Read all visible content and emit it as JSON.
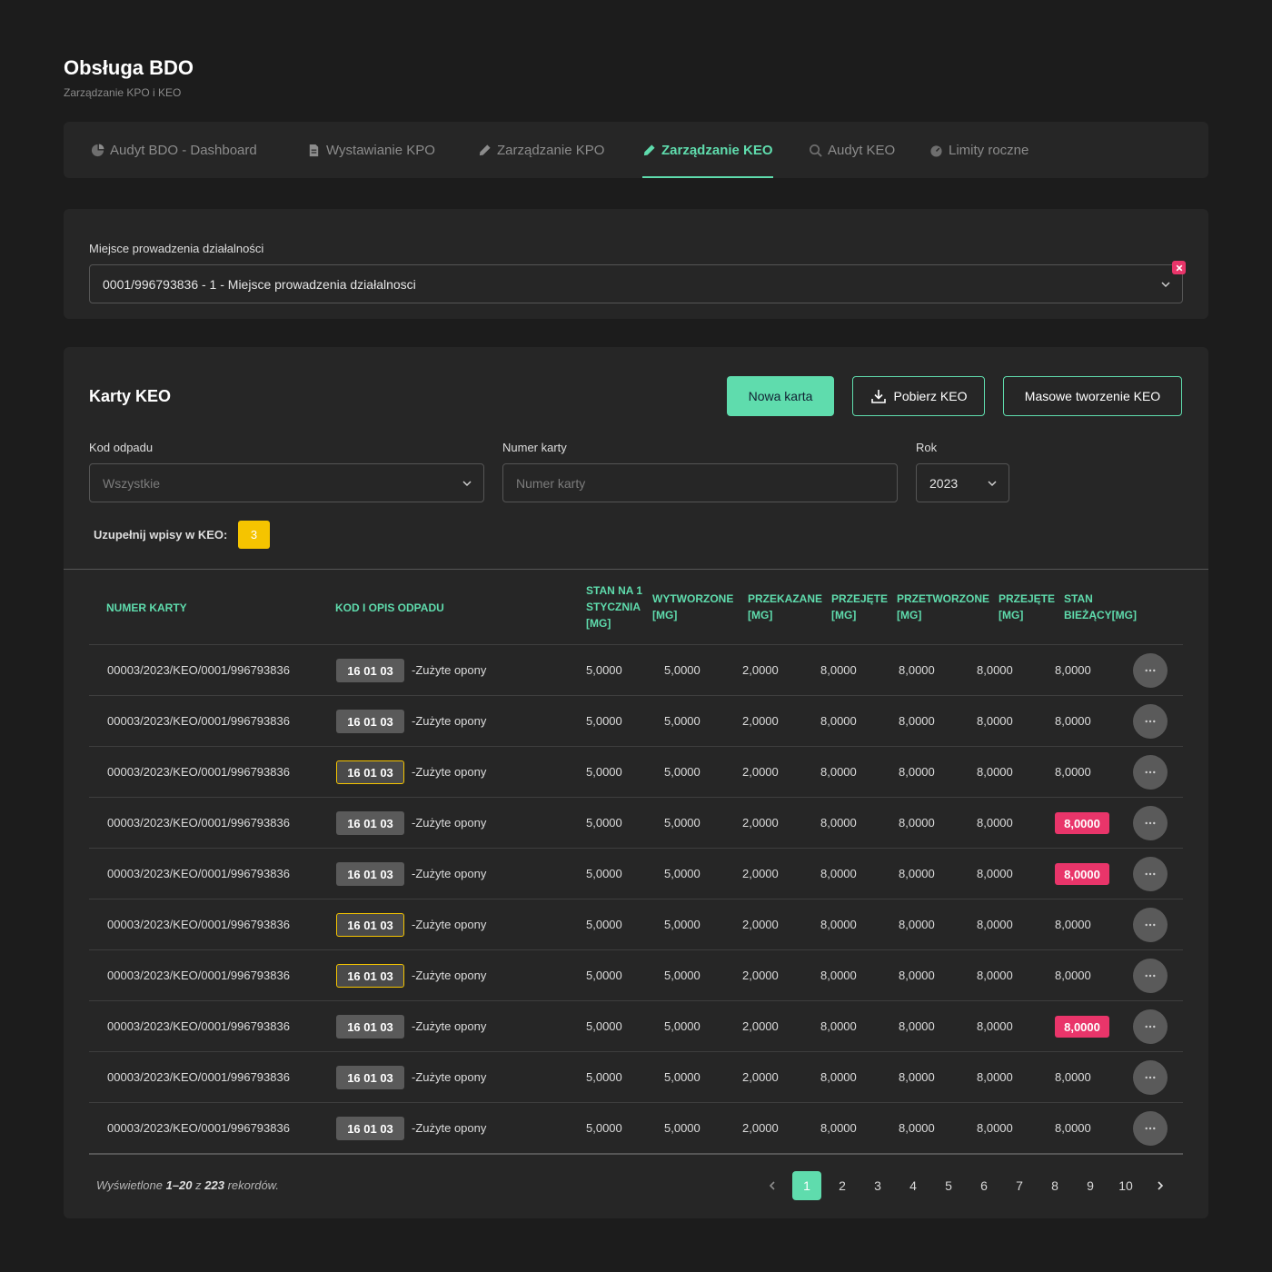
{
  "header": {
    "title": "Obsługa BDO",
    "subtitle": "Zarządzanie KPO i KEO"
  },
  "tabs": [
    {
      "label": "Audyt BDO - Dashboard",
      "icon": "pie-chart-icon"
    },
    {
      "label": "Wystawianie KPO",
      "icon": "document-icon"
    },
    {
      "label": "Zarządzanie KPO",
      "icon": "pencil-icon"
    },
    {
      "label": "Zarządzanie KEO",
      "icon": "pencil-icon",
      "active": true
    },
    {
      "label": "Audyt KEO",
      "icon": "search-icon"
    },
    {
      "label": "Limity roczne",
      "icon": "gauge-icon"
    }
  ],
  "location": {
    "label": "Miejsce prowadzenia działalności",
    "value": "0001/996793836 - 1 - Miejsce prowadzenia działalnosci"
  },
  "cards": {
    "title": "Karty KEO",
    "buttons": {
      "new": "Nowa karta",
      "download": "Pobierz KEO",
      "bulk": "Masowe tworzenie KEO"
    },
    "filters": {
      "code_label": "Kod odpadu",
      "code_value": "Wszystkie",
      "number_label": "Numer karty",
      "number_placeholder": "Numer karty",
      "year_label": "Rok",
      "year_value": "2023"
    },
    "keo_label": "Uzupełnij wpisy w KEO:",
    "keo_count": "3"
  },
  "table": {
    "headers": {
      "number": "Numer karty",
      "code": "Kod i opis odpadu",
      "stan1": [
        "STAN NA 1",
        "STYCZNIA",
        "[Mg]"
      ],
      "wytw": [
        "WYTWORZONE",
        "[Mg]"
      ],
      "przek": [
        "PRZEKAZANE",
        "[Mg]"
      ],
      "przej1": [
        "PRZEJĘTE",
        "[Mg]"
      ],
      "przetw": [
        "PRZETWORZONE",
        "[Mg]"
      ],
      "przej2": [
        "PRZEJĘTE",
        "[Mg]"
      ],
      "stan": [
        "STAN",
        "BIEŻĄCY[Mg]"
      ]
    },
    "rows": [
      {
        "number": "00003/2023/KEO/0001/996793836",
        "code": "16 01 03",
        "desc": "-Zużyte opony",
        "v1": "5,0000",
        "v2": "5,0000",
        "v3": "2,0000",
        "v4": "8,0000",
        "v5": "8,0000",
        "v6": "8,0000",
        "v7": "8,0000",
        "code_hl": false,
        "stan_alert": false
      },
      {
        "number": "00003/2023/KEO/0001/996793836",
        "code": "16 01 03",
        "desc": "-Zużyte opony",
        "v1": "5,0000",
        "v2": "5,0000",
        "v3": "2,0000",
        "v4": "8,0000",
        "v5": "8,0000",
        "v6": "8,0000",
        "v7": "8,0000",
        "code_hl": false,
        "stan_alert": false
      },
      {
        "number": "00003/2023/KEO/0001/996793836",
        "code": "16 01 03",
        "desc": "-Zużyte opony",
        "v1": "5,0000",
        "v2": "5,0000",
        "v3": "2,0000",
        "v4": "8,0000",
        "v5": "8,0000",
        "v6": "8,0000",
        "v7": "8,0000",
        "code_hl": true,
        "stan_alert": false
      },
      {
        "number": "00003/2023/KEO/0001/996793836",
        "code": "16 01 03",
        "desc": "-Zużyte opony",
        "v1": "5,0000",
        "v2": "5,0000",
        "v3": "2,0000",
        "v4": "8,0000",
        "v5": "8,0000",
        "v6": "8,0000",
        "v7": "8,0000",
        "code_hl": false,
        "stan_alert": true
      },
      {
        "number": "00003/2023/KEO/0001/996793836",
        "code": "16 01 03",
        "desc": "-Zużyte opony",
        "v1": "5,0000",
        "v2": "5,0000",
        "v3": "2,0000",
        "v4": "8,0000",
        "v5": "8,0000",
        "v6": "8,0000",
        "v7": "8,0000",
        "code_hl": false,
        "stan_alert": true
      },
      {
        "number": "00003/2023/KEO/0001/996793836",
        "code": "16 01 03",
        "desc": "-Zużyte opony",
        "v1": "5,0000",
        "v2": "5,0000",
        "v3": "2,0000",
        "v4": "8,0000",
        "v5": "8,0000",
        "v6": "8,0000",
        "v7": "8,0000",
        "code_hl": true,
        "stan_alert": false
      },
      {
        "number": "00003/2023/KEO/0001/996793836",
        "code": "16 01 03",
        "desc": "-Zużyte opony",
        "v1": "5,0000",
        "v2": "5,0000",
        "v3": "2,0000",
        "v4": "8,0000",
        "v5": "8,0000",
        "v6": "8,0000",
        "v7": "8,0000",
        "code_hl": true,
        "stan_alert": false
      },
      {
        "number": "00003/2023/KEO/0001/996793836",
        "code": "16 01 03",
        "desc": "-Zużyte opony",
        "v1": "5,0000",
        "v2": "5,0000",
        "v3": "2,0000",
        "v4": "8,0000",
        "v5": "8,0000",
        "v6": "8,0000",
        "v7": "8,0000",
        "code_hl": false,
        "stan_alert": true
      },
      {
        "number": "00003/2023/KEO/0001/996793836",
        "code": "16 01 03",
        "desc": "-Zużyte opony",
        "v1": "5,0000",
        "v2": "5,0000",
        "v3": "2,0000",
        "v4": "8,0000",
        "v5": "8,0000",
        "v6": "8,0000",
        "v7": "8,0000",
        "code_hl": false,
        "stan_alert": false
      },
      {
        "number": "00003/2023/KEO/0001/996793836",
        "code": "16 01 03",
        "desc": "-Zużyte opony",
        "v1": "5,0000",
        "v2": "5,0000",
        "v3": "2,0000",
        "v4": "8,0000",
        "v5": "8,0000",
        "v6": "8,0000",
        "v7": "8,0000",
        "code_hl": false,
        "stan_alert": false
      }
    ]
  },
  "pagination": {
    "prefix": "Wyświetlone",
    "range": "1–20",
    "of": "z",
    "total": "223",
    "suffix": "rekordów.",
    "pages": [
      "1",
      "2",
      "3",
      "4",
      "5",
      "6",
      "7",
      "8",
      "9",
      "10"
    ],
    "current": "1"
  },
  "colors": {
    "accent": "#5fdcad",
    "warning": "#f5c400",
    "alert": "#e9356a",
    "panel": "#262626",
    "background": "#1c1c1c"
  }
}
